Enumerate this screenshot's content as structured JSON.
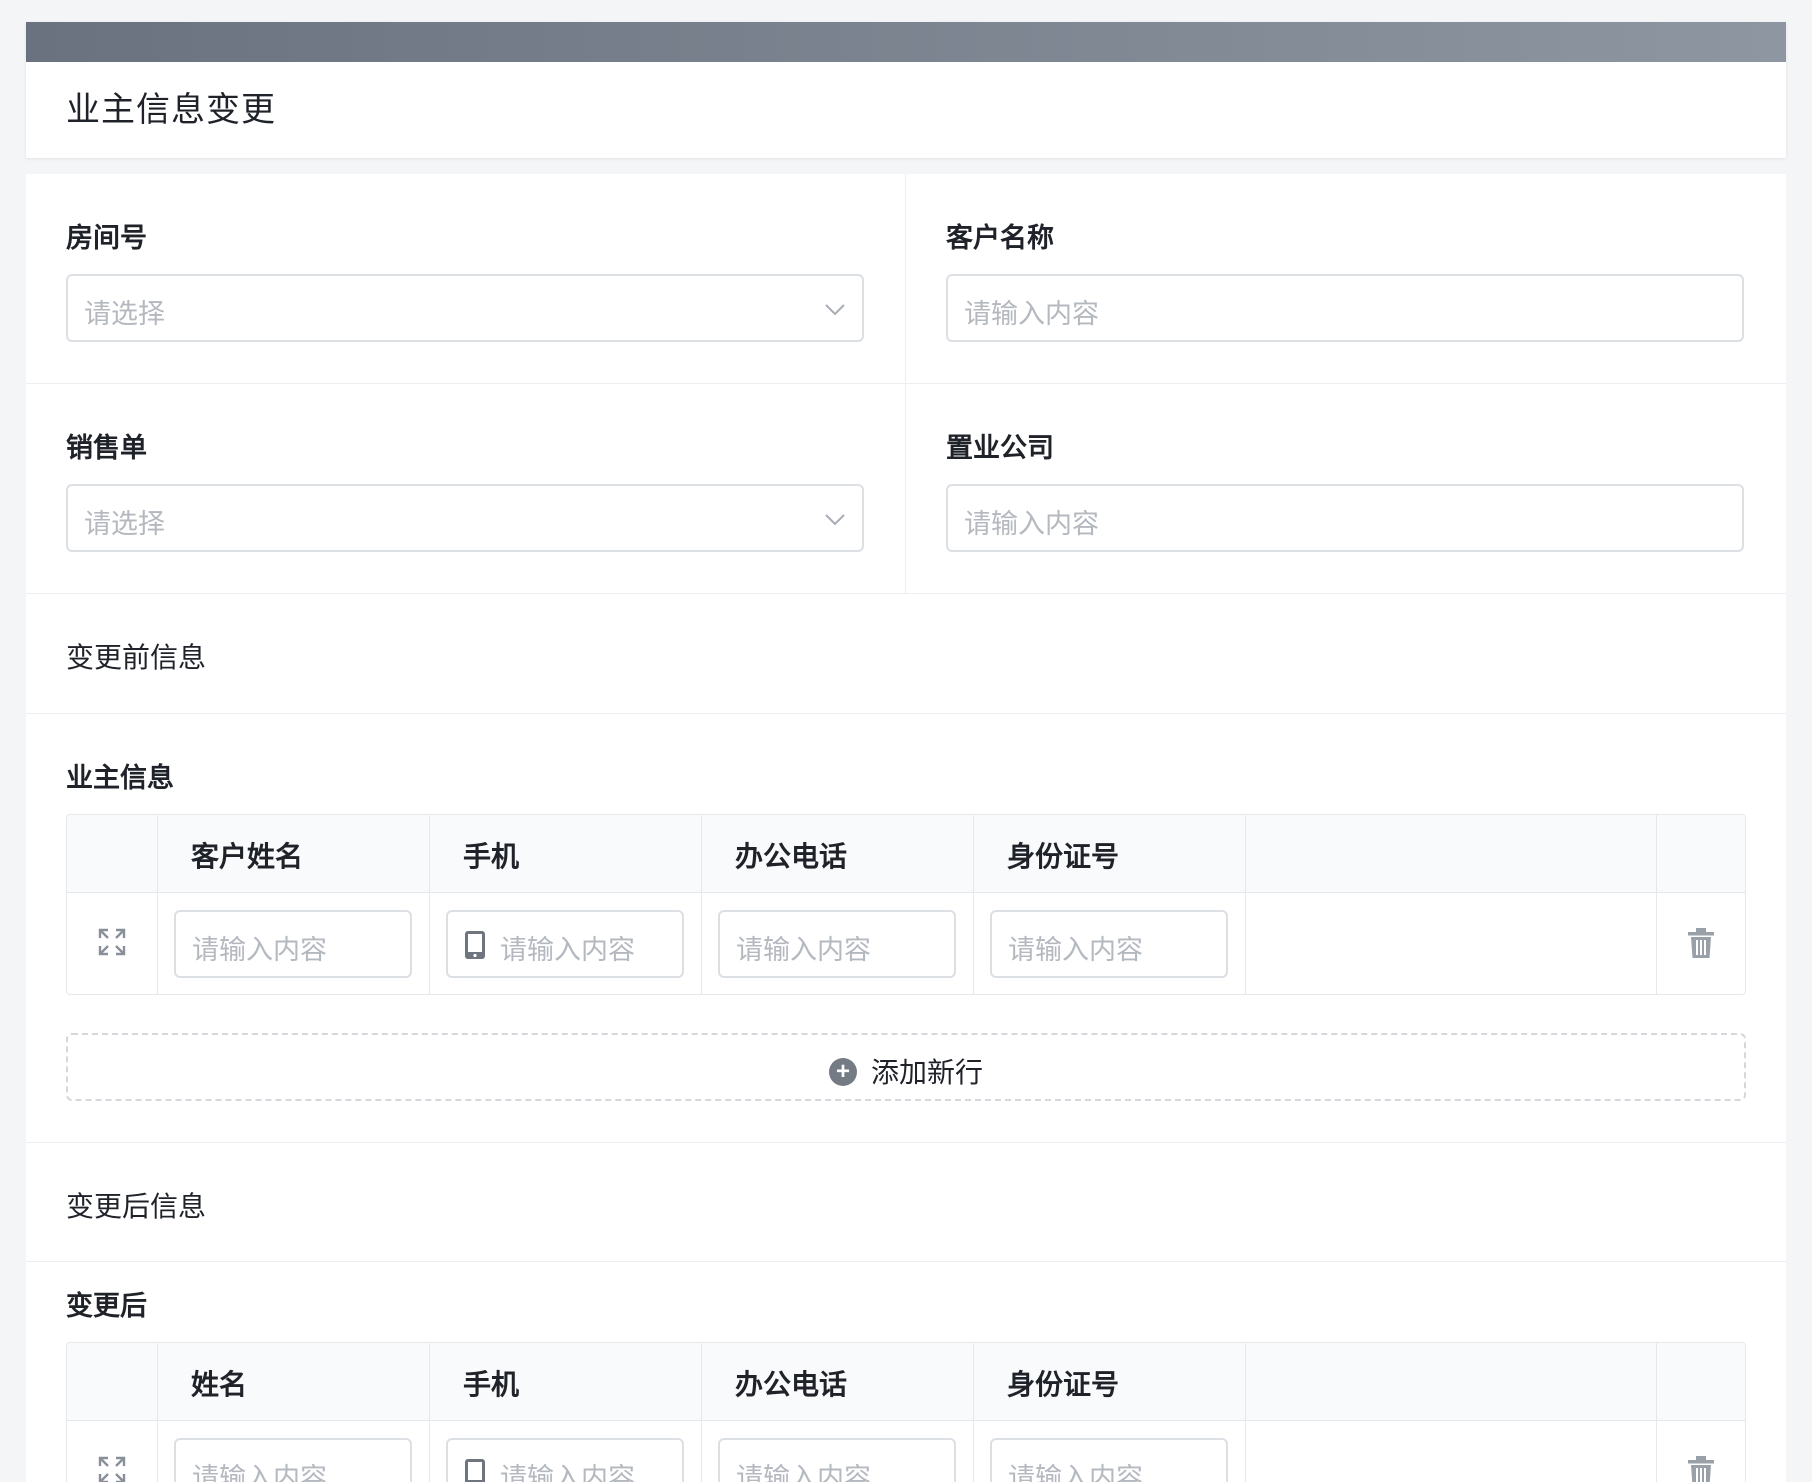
{
  "header": {
    "title": "业主信息变更"
  },
  "fields": {
    "room_no": {
      "label": "房间号",
      "placeholder": "请选择"
    },
    "customer_name": {
      "label": "客户名称",
      "placeholder": "请输入内容"
    },
    "sales_order": {
      "label": "销售单",
      "placeholder": "请选择"
    },
    "property_company": {
      "label": "置业公司",
      "placeholder": "请输入内容"
    }
  },
  "sections": {
    "before": "变更前信息",
    "after": "变更后信息"
  },
  "owner_table": {
    "title": "业主信息",
    "columns": [
      "客户姓名",
      "手机",
      "办公电话",
      "身份证号"
    ],
    "placeholders": [
      "请输入内容",
      "请输入内容",
      "请输入内容",
      "请输入内容"
    ],
    "add_row_label": "添加新行"
  },
  "after_table": {
    "title": "变更后",
    "columns": [
      "姓名",
      "手机",
      "办公电话",
      "身份证号"
    ],
    "placeholders": [
      "请输入内容",
      "请输入内容",
      "请输入内容",
      "请输入内容"
    ]
  },
  "icons": {
    "dropdown": "chevron-down-icon",
    "expand": "expand-icon",
    "phone": "phone-icon",
    "delete": "trash-icon",
    "add": "plus-circle-icon"
  },
  "colors": {
    "header_strip_start": "#6a7280",
    "header_strip_end": "#8e96a1",
    "placeholder": "#b4b8bf",
    "border": "#dcdfe4"
  }
}
